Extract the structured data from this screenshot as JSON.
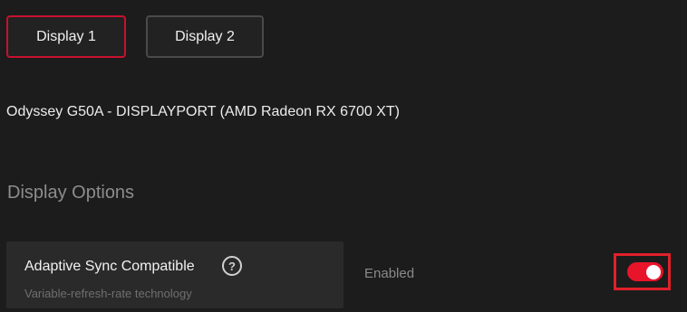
{
  "tabs": [
    {
      "label": "Display 1",
      "active": true
    },
    {
      "label": "Display 2",
      "active": false
    }
  ],
  "monitor": {
    "name": "Odyssey G50A - DISPLAYPORT (AMD Radeon RX 6700 XT)"
  },
  "section": {
    "title": "Display Options"
  },
  "option": {
    "title": "Adaptive Sync Compatible",
    "subtitle": "Variable-refresh-rate technology",
    "help_icon": "question-circle-icon",
    "help_glyph": "?",
    "status": "Enabled",
    "toggle_on": true
  },
  "colors": {
    "accent": "#e8142a",
    "active_tab_border": "#c8102e",
    "highlight_box": "#e0202a",
    "background": "#1c1c1c",
    "card": "#2a2a2a"
  }
}
